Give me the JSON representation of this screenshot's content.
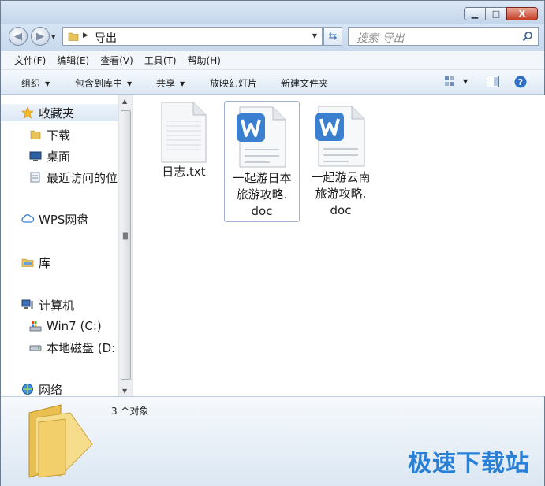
{
  "window": {
    "controls": {
      "minimize": "▭",
      "maximize": "□",
      "close": "X"
    }
  },
  "address": {
    "crumb": "导出",
    "search_placeholder": "搜索 导出"
  },
  "menubar": [
    "文件(F)",
    "编辑(E)",
    "查看(V)",
    "工具(T)",
    "帮助(H)"
  ],
  "toolbar": {
    "organize": "组织",
    "include_library": "包含到库中",
    "share": "共享",
    "slideshow": "放映幻灯片",
    "new_folder": "新建文件夹"
  },
  "nav": {
    "favorites": "收藏夹",
    "downloads": "下载",
    "desktop": "桌面",
    "recent": "最近访问的位",
    "wps": "WPS网盘",
    "library": "库",
    "computer": "计算机",
    "drive_c": "Win7 (C:)",
    "drive_d": "本地磁盘 (D:",
    "network": "网络"
  },
  "files": [
    {
      "lines": [
        "日志.txt"
      ],
      "icon": "text-file-icon"
    },
    {
      "lines": [
        "一起游日本",
        "旅游攻略.",
        "doc"
      ],
      "icon": "wps-doc-icon"
    },
    {
      "lines": [
        "一起游云南",
        "旅游攻略.",
        "doc"
      ],
      "icon": "wps-doc-icon"
    }
  ],
  "details": {
    "count": "3 个对象"
  },
  "watermark": "极速下载站",
  "colors": {
    "accent": "#2a7fd6",
    "wps_blue": "#3b7fd1",
    "folder_yellow": "#f2cf6a"
  }
}
